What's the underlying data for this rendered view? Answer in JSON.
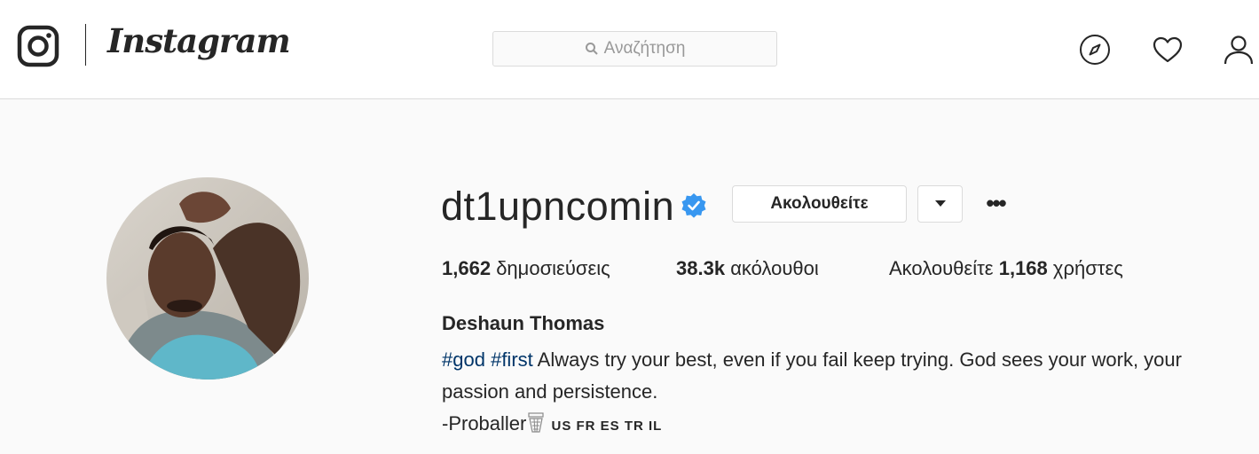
{
  "header": {
    "brand": "Instagram",
    "search_placeholder": "Αναζήτηση",
    "icons": [
      "instagram-glyph-icon",
      "search-icon",
      "compass-icon",
      "heart-icon",
      "user-icon"
    ]
  },
  "profile": {
    "username": "dt1upncomin",
    "verified": true,
    "follow_button": "Ακολουθείτε",
    "more_label": "•••",
    "stats": {
      "posts_count": "1,662",
      "posts_label": "δημοσιεύσεις",
      "followers_count": "38.3k",
      "followers_label": "ακόλουθοι",
      "following_prefix": "Ακολουθείτε",
      "following_count": "1,168",
      "following_suffix": "χρήστες"
    },
    "full_name": "Deshaun Thomas",
    "bio": {
      "tag1": "#god",
      "tag2": "#first",
      "text": "Always try your best, even if you fail keep trying. God sees your work, your passion and persistence.",
      "signature": "-Proballer",
      "flags": "US FR ES TR IL"
    }
  },
  "colors": {
    "background": "#fafafa",
    "text": "#262626",
    "border": "#dbdbdb",
    "verified": "#3897f0",
    "hashtag": "#003569"
  }
}
